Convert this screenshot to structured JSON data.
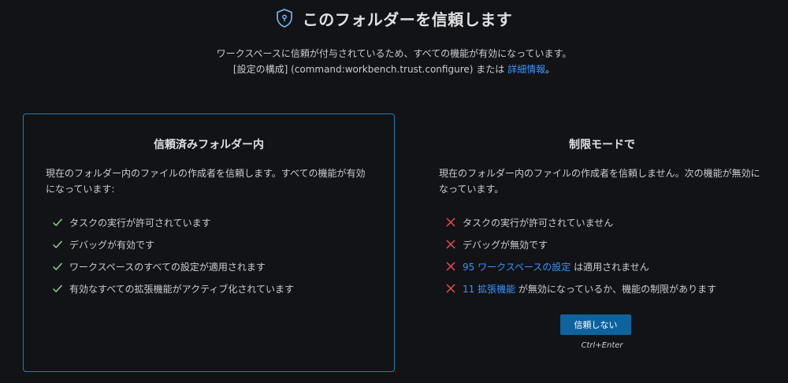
{
  "header": {
    "icon": "shield-icon",
    "title": "このフォルダーを信頼します"
  },
  "subtitle": {
    "line1": "ワークスペースに信頼が付与されているため、すべての機能が有効になっています。",
    "line2_pre": "[設定の構成] (command:workbench.trust.configure) または ",
    "line2_link": "詳細情報",
    "line2_post": "。"
  },
  "trusted": {
    "title": "信頼済みフォルダー内",
    "desc": "現在のフォルダー内のファイルの作成者を信頼します。すべての機能が有効になっています:",
    "items": [
      {
        "icon": "check-icon",
        "text": "タスクの実行が許可されています"
      },
      {
        "icon": "check-icon",
        "text": "デバッグが有効です"
      },
      {
        "icon": "check-icon",
        "text": "ワークスペースのすべての設定が適用されます"
      },
      {
        "icon": "check-icon",
        "text": "有効なすべての拡張機能がアクティブ化されています"
      }
    ]
  },
  "restricted": {
    "title": "制限モードで",
    "desc": "現在のフォルダー内のファイルの作成者を信頼しません。次の機能が無効になっています。",
    "items": [
      {
        "icon": "x-icon",
        "text": "タスクの実行が許可されていません"
      },
      {
        "icon": "x-icon",
        "text": "デバッグが無効です"
      },
      {
        "icon": "x-icon",
        "link": "95 ワークスペースの設定",
        "text": " は適用されません"
      },
      {
        "icon": "x-icon",
        "link": "11 拡張機能",
        "text": " が無効になっているか、機能の制限があります"
      }
    ],
    "button_label": "信頼しない",
    "shortcut": "Ctrl+Enter"
  },
  "colors": {
    "accent": "#3794ff",
    "check": "#89d185",
    "cross": "#f14c4c",
    "button": "#0e639c",
    "card_border": "#1f7fb8"
  }
}
